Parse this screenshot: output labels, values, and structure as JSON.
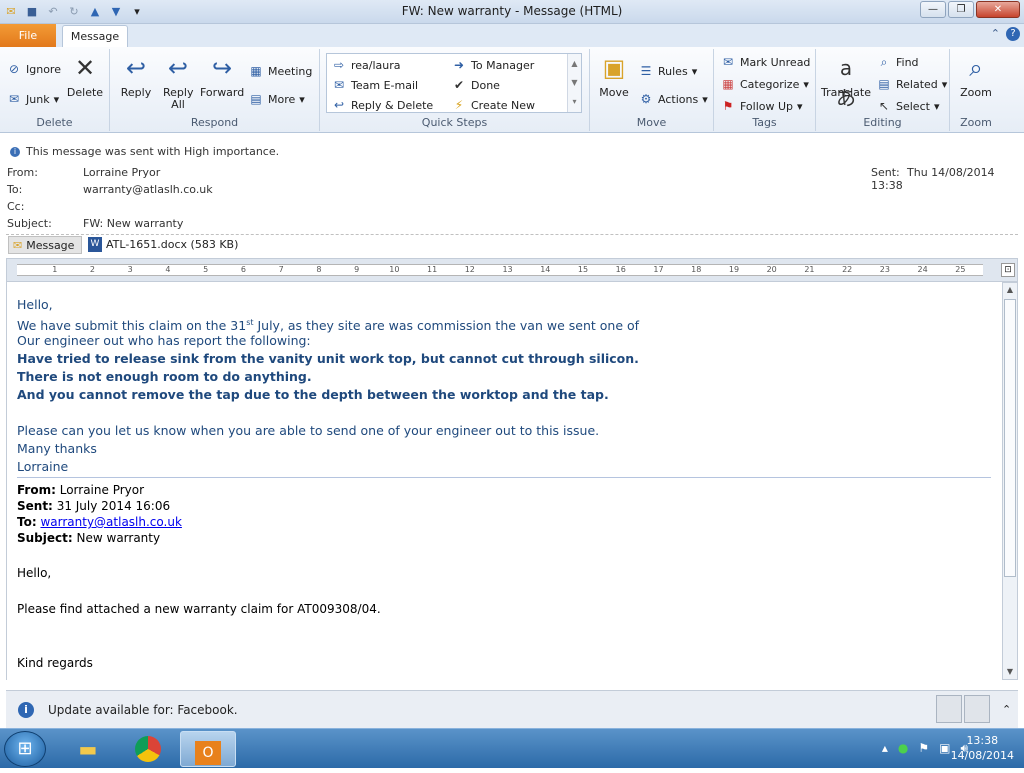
{
  "window": {
    "title": "FW: New warranty  -  Message (HTML)"
  },
  "tabs": {
    "file": "File",
    "message": "Message"
  },
  "ribbon": {
    "delete_group": {
      "label": "Delete",
      "ignore": "Ignore",
      "junk": "Junk",
      "delete": "Delete"
    },
    "respond_group": {
      "label": "Respond",
      "reply": "Reply",
      "reply_all": "Reply All",
      "forward": "Forward",
      "meeting": "Meeting",
      "more": "More"
    },
    "quicksteps_group": {
      "label": "Quick Steps",
      "items": [
        "rea/laura",
        "To Manager",
        "Team E-mail",
        "Done",
        "Reply & Delete",
        "Create New"
      ]
    },
    "move_group": {
      "label": "Move",
      "move": "Move",
      "rules": "Rules",
      "actions": "Actions"
    },
    "tags_group": {
      "label": "Tags",
      "mark_unread": "Mark Unread",
      "categorize": "Categorize",
      "follow_up": "Follow Up"
    },
    "editing_group": {
      "label": "Editing",
      "translate": "Translate",
      "find": "Find",
      "related": "Related",
      "select": "Select"
    },
    "zoom_group": {
      "label": "Zoom",
      "zoom": "Zoom"
    }
  },
  "header": {
    "importance": "This message was sent with High importance.",
    "from_label": "From:",
    "from": "Lorraine Pryor",
    "to_label": "To:",
    "to": "warranty@atlaslh.co.uk",
    "cc_label": "Cc:",
    "subject_label": "Subject:",
    "subject": "FW: New warranty",
    "sent_label": "Sent:",
    "sent": "Thu 14/08/2014 13:38"
  },
  "attachments": {
    "message_tab": "Message",
    "file": "ATL-1651.docx (583 KB)"
  },
  "ruler": {
    "marks": [
      "1",
      "2",
      "3",
      "4",
      "5",
      "6",
      "7",
      "8",
      "9",
      "10",
      "11",
      "12",
      "13",
      "14",
      "15",
      "16",
      "17",
      "18",
      "19",
      "20",
      "21",
      "22",
      "23",
      "24",
      "25"
    ]
  },
  "body": {
    "greeting": "Hello,",
    "line1_a": "We have submit this claim on the 31",
    "line1_sup": "st",
    "line1_b": " July, as they site are was  commission the van we sent one of",
    "line2": "Our engineer out who has report the following:",
    "bold1": "Have tried to release sink from the vanity unit work top, but cannot cut through silicon.",
    "bold2": "There is not enough room to do anything.",
    "bold3": "And you cannot remove the tap due to the depth between the worktop and the tap.",
    "line3": "Please can you let us know when you are able to send one of your engineer out to this issue.",
    "thanks": "Many thanks",
    "name": "Lorraine",
    "fwd_from_label": "From:",
    "fwd_from": "Lorraine Pryor",
    "fwd_sent_label": "Sent:",
    "fwd_sent": "31 July 2014 16:06",
    "fwd_to_label": "To:",
    "fwd_to": "warranty@atlaslh.co.uk",
    "fwd_subject_label": "Subject:",
    "fwd_subject": "New warranty",
    "fwd_greeting": "Hello,",
    "fwd_line": "Please find attached a new warranty claim for AT009308/04.",
    "fwd_regards": "Kind regards"
  },
  "notification": {
    "text": "Update available for: Facebook."
  },
  "taskbar": {
    "time": "13:38",
    "date": "14/08/2014"
  }
}
